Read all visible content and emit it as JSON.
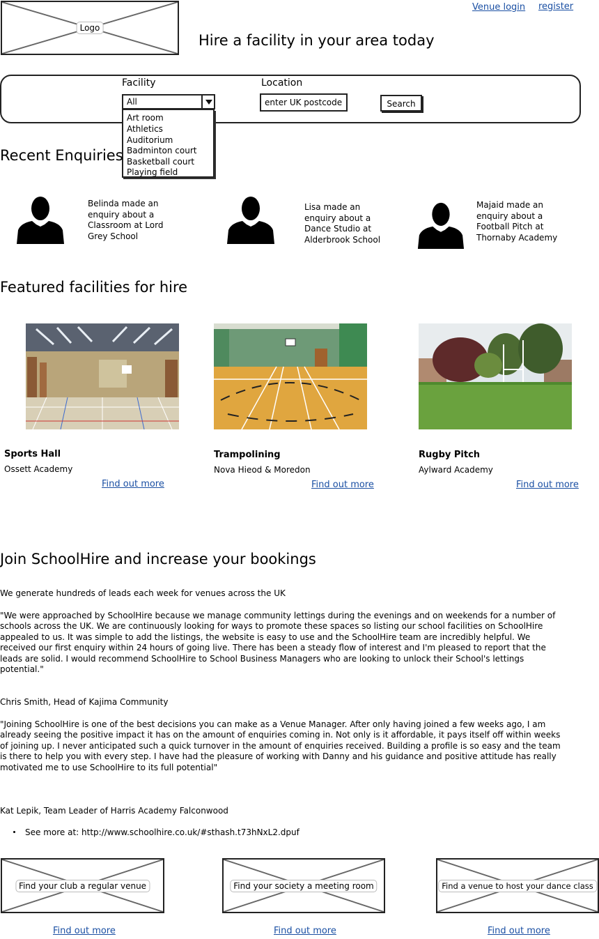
{
  "header": {
    "logo_label": "Logo",
    "tagline": "Hire a facility in your area today",
    "venue_login": "Venue login",
    "register": "register"
  },
  "search": {
    "facility_label": "Facility",
    "facility_selected": "All",
    "facility_options": [
      "Art room",
      "Athletics",
      "Auditorium",
      "Badminton court",
      "Basketball court",
      "Playing field"
    ],
    "location_label": "Location",
    "location_value": "enter UK postcode",
    "search_button": "Search"
  },
  "enquiries": {
    "title": "Recent Enquiries",
    "items": [
      {
        "text": "Belinda made an enquiry about a Classroom at Lord Grey School"
      },
      {
        "text": "Lisa made an enquiry about a Dance Studio at Alderbrook School"
      },
      {
        "text": "Majaid made an enquiry about a Football Pitch at Thornaby Academy"
      }
    ]
  },
  "featured": {
    "title": "Featured facilities for hire",
    "items": [
      {
        "name": "Sports Hall",
        "venue": "Ossett Academy",
        "link": "Find out more"
      },
      {
        "name": "Trampolining",
        "venue": "Nova Hieod & Moredon",
        "link": "Find out more"
      },
      {
        "name": "Rugby Pitch",
        "venue": "Aylward Academy",
        "link": "Find out more"
      }
    ]
  },
  "join": {
    "title": "Join SchoolHire and increase your bookings",
    "intro": "We generate hundreds of leads each week for venues across the UK",
    "quote1": "\"We were approached by SchoolHire because we manage community lettings during the evenings and on weekends for a number of schools across the UK. We are continuously looking for ways to promote these spaces so listing our school facilities on SchoolHire appealed to us. It was simple to add the listings, the website is easy to use and the SchoolHire team are incredibly helpful. We received our first enquiry within 24 hours of going live. There has been a steady flow of interest and I'm pleased to report that the leads are solid. I would recommend SchoolHire to School Business Managers who are looking to unlock their School's lettings potential.\"",
    "author1": "Chris Smith, Head of Kajima Community",
    "quote2": "\"Joining SchoolHire is one of the best decisions you can make as a Venue Manager. After only having joined a few weeks ago, I am already seeing the positive impact it has on the amount of enquiries coming in. Not only is it affordable, it pays itself off within weeks of joining up. I never anticipated such a quick turnover in the amount of enquiries received. Building a profile is so easy and the team is there to help you with every step. I have had the pleasure of working with Danny and his guidance and positive attitude has really motivated me to use SchoolHire to its full potential\"",
    "author2": "Kat Lepik, Team Leader of Harris Academy Falconwood",
    "see_more": "See more at: http://www.schoolhire.co.uk/#sthash.t73hNxL2.dpuf"
  },
  "promos": [
    {
      "label": "Find your club a regular venue",
      "link": "Find out more"
    },
    {
      "label": "Find your society a meeting room",
      "link": "Find out more"
    },
    {
      "label": "Find a venue to host your dance class",
      "link": "Find out more"
    }
  ]
}
